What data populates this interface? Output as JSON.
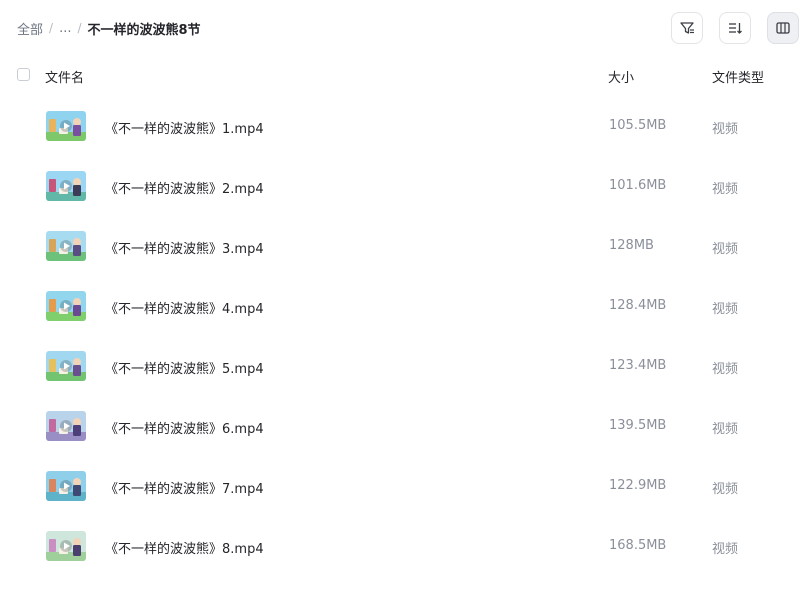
{
  "breadcrumb": {
    "root": "全部",
    "ellipsis": "...",
    "current": "不一样的波波熊8节"
  },
  "toolbar": {
    "buttons": [
      {
        "icon": "filter-icon"
      },
      {
        "icon": "sort-icon"
      },
      {
        "icon": "column-view-icon",
        "active": true
      }
    ]
  },
  "table": {
    "columns": {
      "name": "文件名",
      "size": "大小",
      "type": "文件类型"
    },
    "rows": [
      {
        "name": "《不一样的波波熊》1.mp4",
        "size": "105.5MB",
        "type": "视频",
        "thumb_icon": "video-thumbnail-play-icon"
      },
      {
        "name": "《不一样的波波熊》2.mp4",
        "size": "101.6MB",
        "type": "视频",
        "thumb_icon": "video-thumbnail-play-icon"
      },
      {
        "name": "《不一样的波波熊》3.mp4",
        "size": "128MB",
        "type": "视频",
        "thumb_icon": "video-thumbnail-play-icon"
      },
      {
        "name": "《不一样的波波熊》4.mp4",
        "size": "128.4MB",
        "type": "视频",
        "thumb_icon": "video-thumbnail-play-icon"
      },
      {
        "name": "《不一样的波波熊》5.mp4",
        "size": "123.4MB",
        "type": "视频",
        "thumb_icon": "video-thumbnail-play-icon"
      },
      {
        "name": "《不一样的波波熊》6.mp4",
        "size": "139.5MB",
        "type": "视频",
        "thumb_icon": "video-thumbnail-play-icon"
      },
      {
        "name": "《不一样的波波熊》7.mp4",
        "size": "122.9MB",
        "type": "视频",
        "thumb_icon": "video-thumbnail-play-icon"
      },
      {
        "name": "《不一样的波波熊》8.mp4",
        "size": "168.5MB",
        "type": "视频",
        "thumb_icon": "video-thumbnail-play-icon"
      }
    ]
  }
}
